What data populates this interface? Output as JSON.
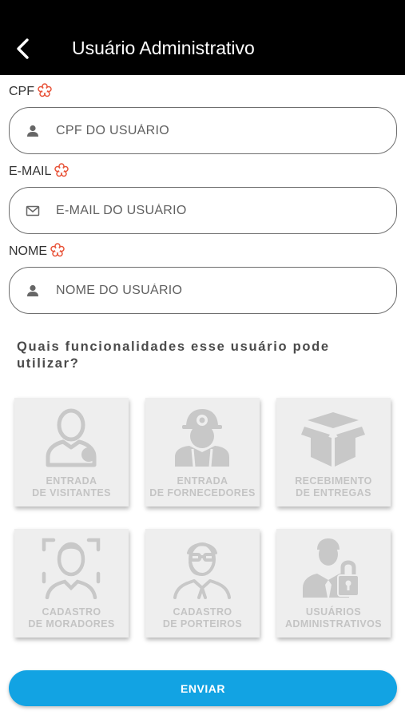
{
  "header": {
    "title": "Usuário Administrativo",
    "back_icon": "chevron-left-icon"
  },
  "form": {
    "cpf": {
      "label": "CPF",
      "placeholder": "CPF DO USUÁRIO",
      "value": "",
      "icon": "person-icon"
    },
    "email": {
      "label": "E-MAIL",
      "placeholder": "E-MAIL DO USUÁRIO",
      "value": "",
      "icon": "envelope-icon"
    },
    "nome": {
      "label": "NOME",
      "placeholder": "NOME DO USUÁRIO",
      "value": "",
      "icon": "person-icon"
    },
    "required_icon": "required-asterisk-icon"
  },
  "features": {
    "question": "Quais funcionalidades esse usuário pode utilizar?",
    "items": [
      {
        "label": "ENTRADA\nDE VISITANTES",
        "icon": "visitor-icon"
      },
      {
        "label": "ENTRADA\nDE FORNECEDORES",
        "icon": "supplier-icon"
      },
      {
        "label": "RECEBIMENTO\nDE ENTREGAS",
        "icon": "package-icon"
      },
      {
        "label": "CADASTRO\nDE MORADORES",
        "icon": "face-scan-icon"
      },
      {
        "label": "CADASTRO\nDE PORTEIROS",
        "icon": "doorman-icon"
      },
      {
        "label": "USUÁRIOS\nADMINISTRATIVOS",
        "icon": "admin-lock-icon"
      }
    ]
  },
  "actions": {
    "submit_label": "ENVIAR"
  },
  "colors": {
    "header_bg": "#000000",
    "accent": "#12a3e3",
    "required": "#e8543a",
    "card_bg": "#eeeeee",
    "card_text": "#c4c4c4"
  }
}
